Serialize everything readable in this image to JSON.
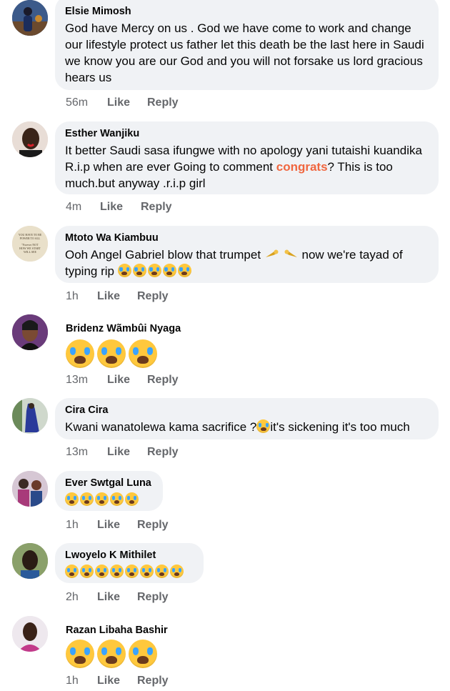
{
  "comments": [
    {
      "name": "Elsie Mimosh",
      "text": "God have Mercy on us . God we have come to work and change our lifestyle protect us father   let this death be the last here in Saudi we know you are our God and you will not forsake us lord gracious hears us",
      "time": "56m",
      "like": "Like",
      "reply": "Reply"
    },
    {
      "name": "Esther Wanjiku",
      "text_before": "It better Saudi sasa ifungwe with no apology yani tutaishi kuandika R.i.p when are ever Going to comment ",
      "highlight": "congrats",
      "text_after": "? This is too much.but anyway .r.i.p girl",
      "time": "4m",
      "like": "Like",
      "reply": "Reply"
    },
    {
      "name": "Mtoto Wa Kiambuu",
      "text_before": "Ooh Angel Gabriel blow that trumpet ",
      "text_after": " now we're tayad of typing rip ",
      "avatar_text": "YOU HAVE TO BE POWER TO ALL \"Forever NOT HOW WE START WILL SEE",
      "time": "1h",
      "like": "Like",
      "reply": "Reply"
    },
    {
      "name": "Bridenz Wãmbûi Nyaga",
      "time": "13m",
      "like": "Like",
      "reply": "Reply"
    },
    {
      "name": "Cira Cira",
      "text_before": "Kwani wanatolewa kama sacrifice ?",
      "text_after": "it's  sickening it's too much",
      "time": "13m",
      "like": "Like",
      "reply": "Reply"
    },
    {
      "name": "Ever Swtgal Luna",
      "time": "1h",
      "like": "Like",
      "reply": "Reply"
    },
    {
      "name": "Lwoyelo K Mithilet",
      "time": "2h",
      "like": "Like",
      "reply": "Reply"
    },
    {
      "name": "Razan Libaha Bashir",
      "time": "1h",
      "like": "Like",
      "reply": "Reply"
    }
  ],
  "icons": {
    "emoji": "loudly-crying-face",
    "trumpet": "trumpet"
  },
  "colors": {
    "bubble": "#f0f2f5",
    "highlight": "#f0663f",
    "meta": "#65676b"
  }
}
